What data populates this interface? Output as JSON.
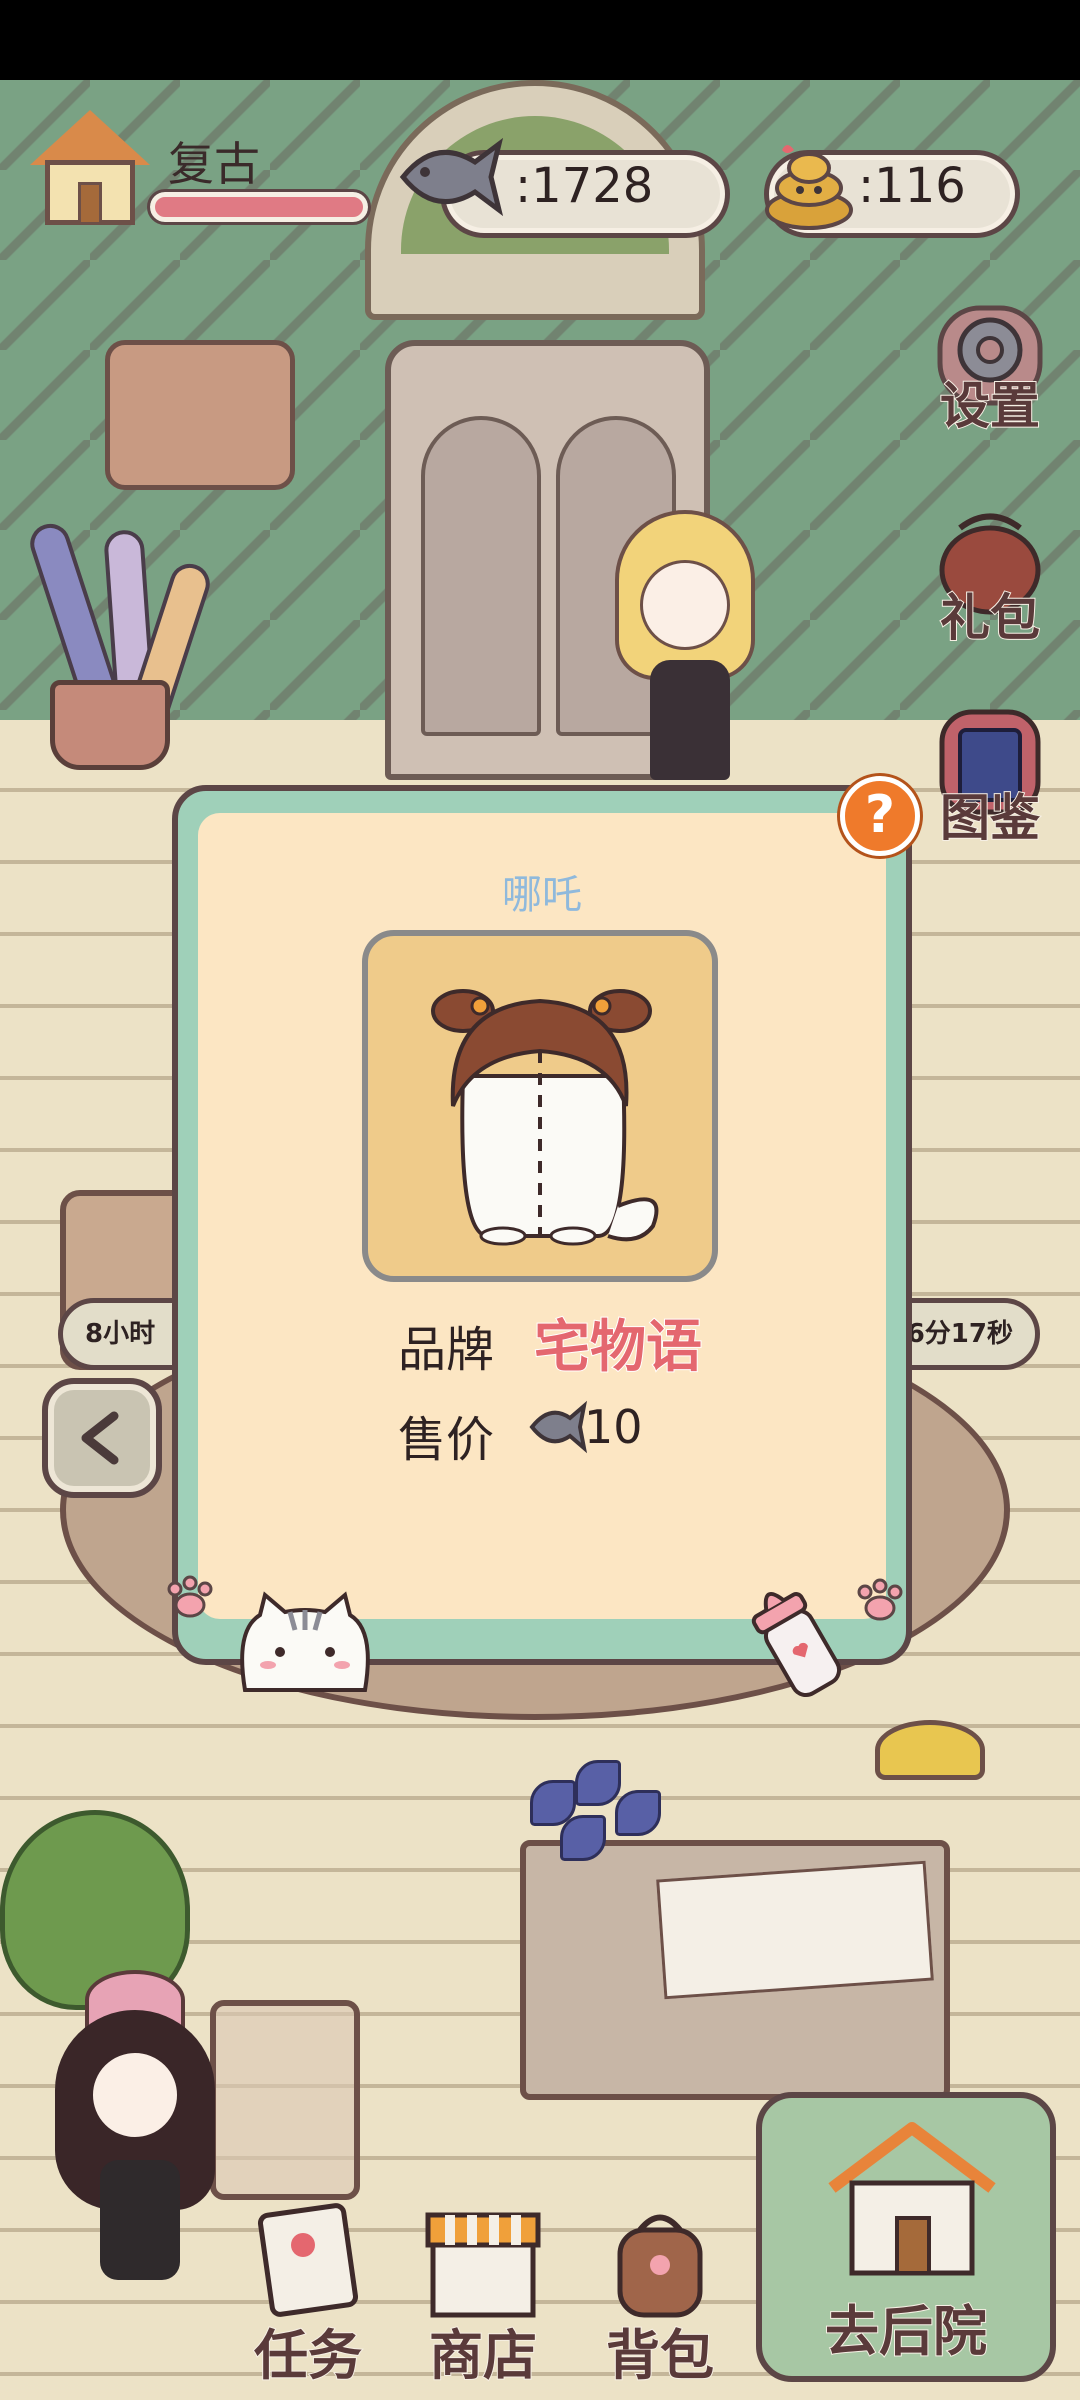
{
  "hud": {
    "player_name": "复古",
    "fish_amount": ":1728",
    "poop_amount": ":116"
  },
  "side_menu": {
    "settings_label": "设置",
    "gift_label": "礼包",
    "handbook_label": "图鉴"
  },
  "timers": {
    "left": "8小时",
    "right": "6分17秒"
  },
  "popup": {
    "help_symbol": "?",
    "item_name": "哪吒",
    "brand_label": "品牌",
    "brand_value": "宅物语",
    "price_label": "售价",
    "price_value": "10"
  },
  "bottom_nav": {
    "task_label": "任务",
    "shop_label": "商店",
    "bag_label": "背包",
    "backyard_label": "去后院"
  },
  "colors": {
    "accent_pink": "#e4676f",
    "popup_border": "#9fd0b9",
    "popup_bg": "#fce6c3",
    "help_orange": "#ef7a2b",
    "item_name_blue": "#8fb9dc"
  }
}
